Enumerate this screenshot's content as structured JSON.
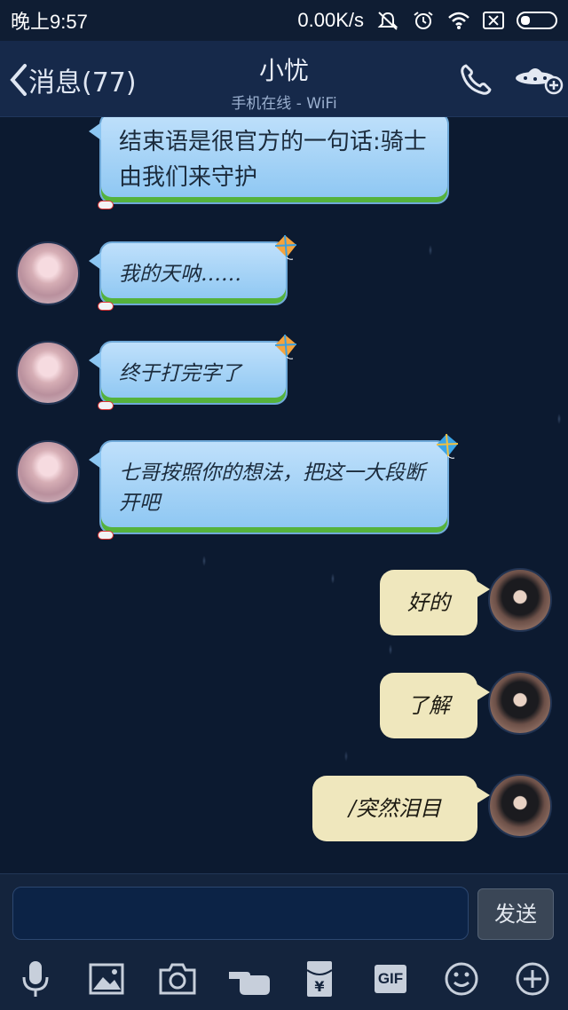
{
  "status_bar": {
    "time": "晚上9:57",
    "network_speed": "0.00K/s",
    "icons": [
      "mute-icon",
      "alarm-icon",
      "wifi-icon",
      "no-sim-icon",
      "battery-icon"
    ]
  },
  "header": {
    "back_label": "消息(77)",
    "contact_name": "小忧",
    "contact_status": "手机在线 - WiFi",
    "icons": [
      "phone-icon",
      "ufo-add-icon"
    ]
  },
  "messages": [
    {
      "side": "left",
      "text": "结束语是很官方的一句话:骑士由我们来守护"
    },
    {
      "side": "left",
      "text": "我的天呐……"
    },
    {
      "side": "left",
      "text": "终于打完字了"
    },
    {
      "side": "left",
      "text": "七哥按照你的想法，把这一大段断开吧"
    },
    {
      "side": "right",
      "text": "好的"
    },
    {
      "side": "right",
      "text": "了解"
    },
    {
      "side": "right",
      "text": "/突然泪目"
    }
  ],
  "composer": {
    "input_value": "",
    "send_label": "发送"
  },
  "toolbar": {
    "items": [
      "microphone-icon",
      "image-icon",
      "camera-icon",
      "poke-icon",
      "red-packet-icon",
      "gif-icon",
      "emoji-icon",
      "plus-icon"
    ],
    "gif_label": "GIF"
  },
  "colors": {
    "header_bg": "#16294a",
    "chat_bg": "#0c1a30",
    "left_bubble": "#a8d4f6",
    "right_bubble": "#efe7bd"
  }
}
